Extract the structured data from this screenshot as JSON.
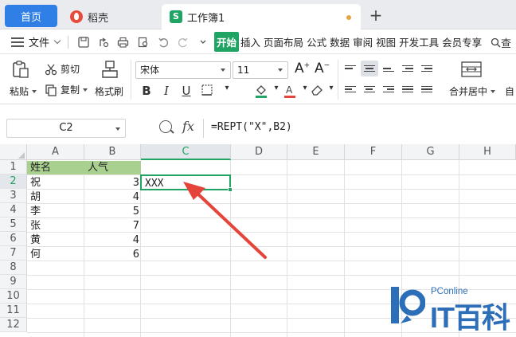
{
  "tabs": {
    "home": "首页",
    "shell": "稻壳",
    "workbook": "工作簿1"
  },
  "menu": {
    "file": "文件",
    "items": [
      "开始",
      "插入",
      "页面布局",
      "公式",
      "数据",
      "审阅",
      "视图",
      "开发工具",
      "会员专享"
    ],
    "active": "开始",
    "search_fragment": "查"
  },
  "ribbon": {
    "paste": "粘贴",
    "cut": "剪切",
    "copy": "复制",
    "format_painter": "格式刷",
    "font_name": "宋体",
    "font_size": "11",
    "merge_center": "合并居中",
    "auto_fragment": "自"
  },
  "formula_bar": {
    "name_box": "C2",
    "fx": "fx",
    "formula": "=REPT(\"X\",B2)"
  },
  "sheet": {
    "columns": [
      "A",
      "B",
      "C",
      "D",
      "E",
      "F",
      "G",
      "H"
    ],
    "selected_column": "C",
    "rows": [
      "1",
      "2",
      "3",
      "4",
      "5",
      "6",
      "7",
      "8",
      "9",
      "10",
      "11",
      "12"
    ],
    "selected_row": "2",
    "header_a": "姓名",
    "header_b": "人气",
    "names": [
      "祝",
      "胡",
      "李",
      "张",
      "黄",
      "何"
    ],
    "values": [
      "3",
      "4",
      "5",
      "7",
      "4",
      "6"
    ],
    "c2": "XXX",
    "header_fill_color": "#a9d08e",
    "accent_color": "#1fa463",
    "arrow_color": "#e5443a"
  },
  "watermark": {
    "sub": "PConline",
    "main": "IT百科"
  }
}
